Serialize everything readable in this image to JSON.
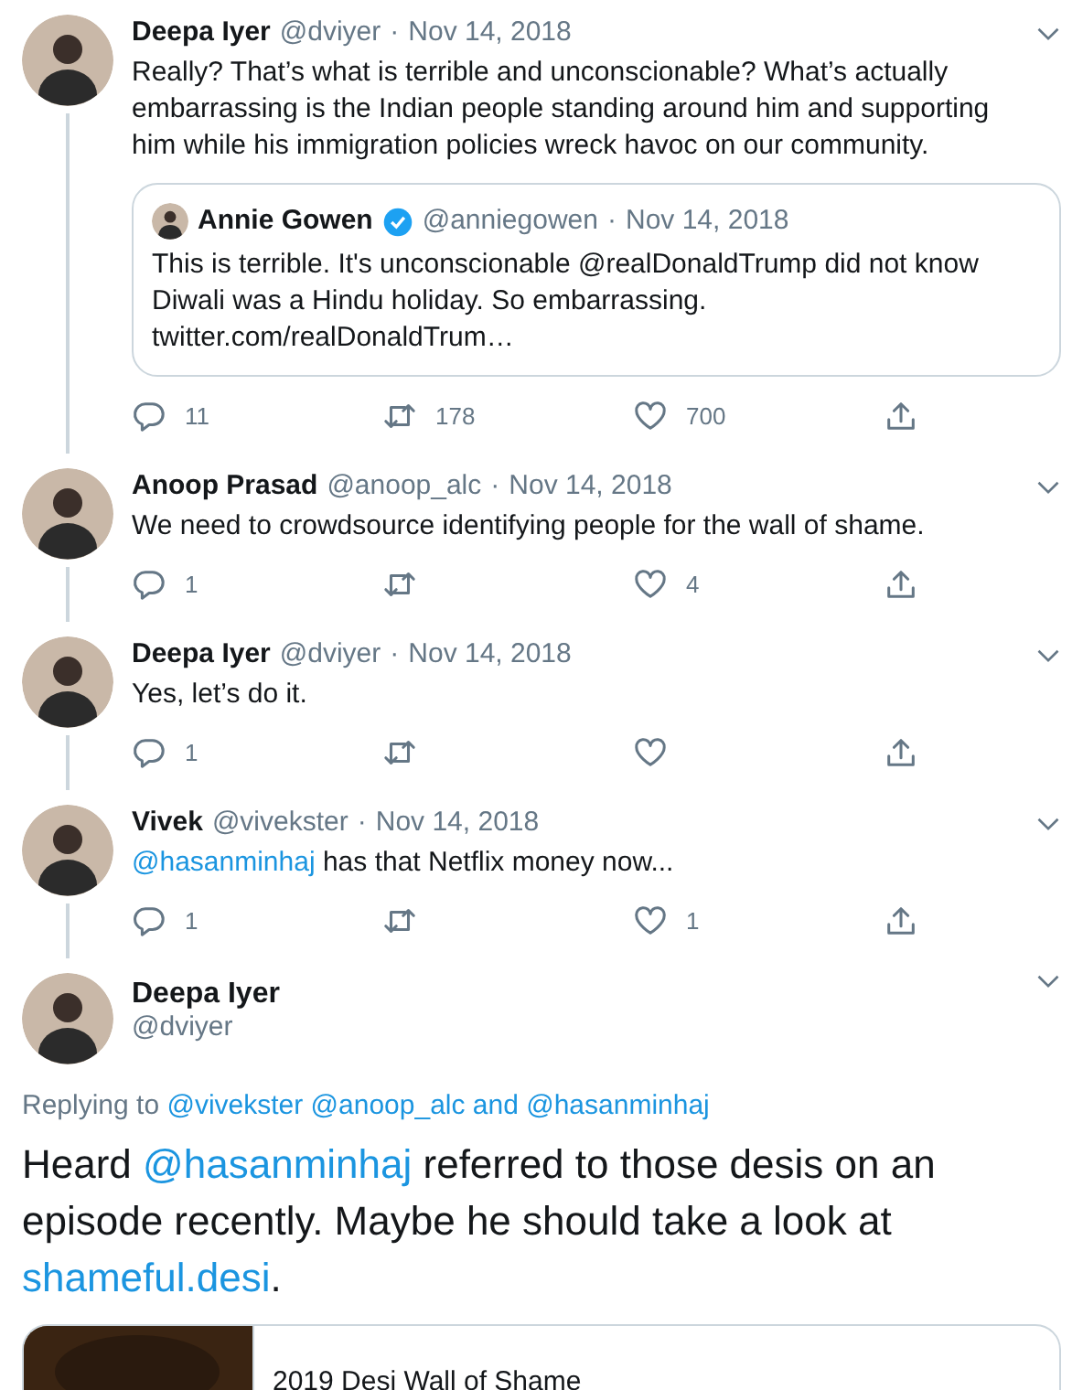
{
  "tweets": [
    {
      "kind": "reply",
      "name": "Deepa Iyer",
      "handle": "@dviyer",
      "separator": "·",
      "date": "Nov 14, 2018",
      "text": [
        {
          "kind": "plain",
          "text": "Really? That’s what is terrible and unconscionable? What’s actually embarrassing is the Indian people standing around him and supporting him while his immigration policies wreck havoc on our community."
        }
      ],
      "quote": {
        "name": "Annie Gowen",
        "verified": true,
        "handle": "@anniegowen",
        "separator": "·",
        "date": "Nov 14, 2018",
        "text": "This is terrible.  It's unconscionable @realDonaldTrump did not know Diwali was a Hindu holiday. So embarrassing. twitter.com/realDonaldTrum…"
      },
      "actions": [
        {
          "kind": "reply",
          "count": "11"
        },
        {
          "kind": "retweet",
          "count": "178"
        },
        {
          "kind": "like",
          "count": "700"
        },
        {
          "kind": "share"
        }
      ]
    },
    {
      "kind": "reply",
      "name": "Anoop Prasad",
      "handle": "@anoop_alc",
      "separator": "·",
      "date": "Nov 14, 2018",
      "text": [
        {
          "kind": "plain",
          "text": "We need to crowdsource identifying people for the wall of shame."
        }
      ],
      "actions": [
        {
          "kind": "reply",
          "count": "1"
        },
        {
          "kind": "retweet"
        },
        {
          "kind": "like",
          "count": "4"
        },
        {
          "kind": "share"
        }
      ]
    },
    {
      "kind": "reply",
      "name": "Deepa Iyer",
      "handle": "@dviyer",
      "separator": "·",
      "date": "Nov 14, 2018",
      "text": [
        {
          "kind": "plain",
          "text": "Yes, let’s do it."
        }
      ],
      "actions": [
        {
          "kind": "reply",
          "count": "1"
        },
        {
          "kind": "retweet"
        },
        {
          "kind": "like"
        },
        {
          "kind": "share"
        }
      ]
    },
    {
      "kind": "reply",
      "name": "Vivek",
      "handle": "@vivekster",
      "separator": "·",
      "date": "Nov 14, 2018",
      "text": [
        {
          "kind": "link",
          "text": "@hasanminhaj"
        },
        {
          "kind": "plain",
          "text": " has that Netflix money now..."
        }
      ],
      "actions": [
        {
          "kind": "reply",
          "count": "1"
        },
        {
          "kind": "retweet"
        },
        {
          "kind": "like",
          "count": "1"
        },
        {
          "kind": "share"
        }
      ]
    },
    {
      "kind": "focused",
      "name": "Deepa Iyer",
      "handle": "@dviyer",
      "replying": [
        {
          "kind": "plain",
          "text": "Replying to "
        },
        {
          "kind": "link",
          "text": "@vivekster @anoop_alc and @hasanminhaj"
        }
      ],
      "text": [
        {
          "kind": "plain",
          "text": "Heard "
        },
        {
          "kind": "link",
          "text": "@hasanminhaj"
        },
        {
          "kind": "plain",
          "text": " referred to those desis on an episode recently. Maybe he should take a look at "
        },
        {
          "kind": "link",
          "text": "shameful.desi"
        },
        {
          "kind": "plain",
          "text": "."
        }
      ],
      "card": {
        "title": "2019 Desi Wall of Shame"
      }
    }
  ]
}
